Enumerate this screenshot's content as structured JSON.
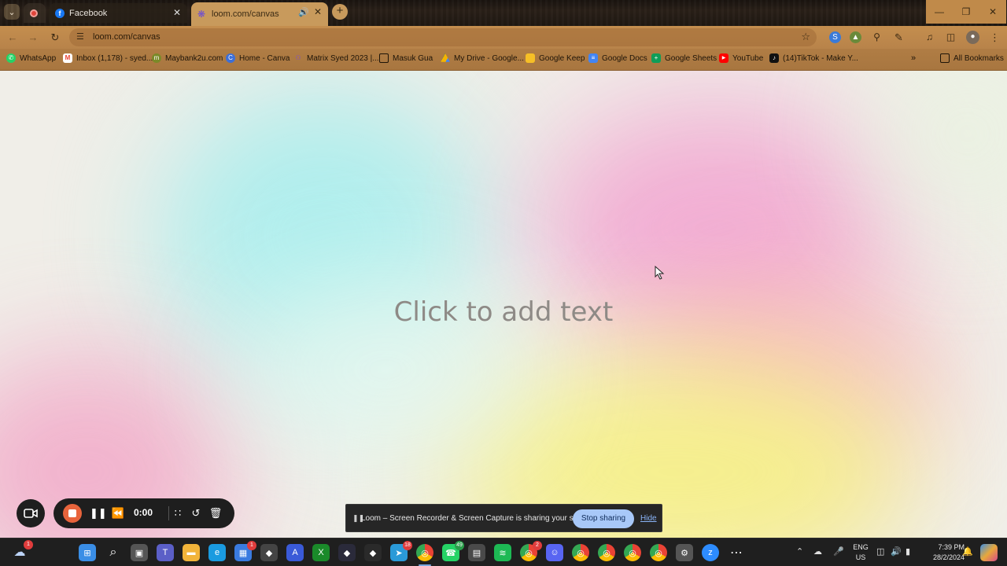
{
  "browser": {
    "tabs": [
      {
        "title": "",
        "icon": "record-icon"
      },
      {
        "title": "Facebook",
        "icon": "facebook-icon"
      },
      {
        "title": "loom.com/canvas",
        "icon": "loom-icon",
        "active": true,
        "audio": true
      }
    ],
    "address": {
      "url": "loom.com/canvas"
    },
    "bookmarks": [
      {
        "label": "WhatsApp",
        "icon": "whatsapp-icon",
        "color": "#25d366"
      },
      {
        "label": "Inbox (1,178) - syed...",
        "icon": "gmail-icon",
        "color": "#ea4335"
      },
      {
        "label": "Maybank2u.com",
        "icon": "maybank-icon",
        "color": "#7a8a28"
      },
      {
        "label": "Home - Canva",
        "icon": "canva-icon",
        "color": "#3d6fd8"
      },
      {
        "label": "Matrix Syed 2023 |...",
        "icon": "bookmark-icon",
        "color": "#9a6ad8"
      },
      {
        "label": "Masuk Gua",
        "icon": "folder-icon",
        "color": "#1e1408"
      },
      {
        "label": "My Drive - Google...",
        "icon": "drive-icon",
        "color": "#f4b400"
      },
      {
        "label": "Google Keep",
        "icon": "keep-icon",
        "color": "#f6bf26"
      },
      {
        "label": "Google Docs",
        "icon": "docs-icon",
        "color": "#4285f4"
      },
      {
        "label": "Google Sheets",
        "icon": "sheets-icon",
        "color": "#0f9d58"
      },
      {
        "label": "YouTube",
        "icon": "youtube-icon",
        "color": "#ff0000"
      },
      {
        "label": "(14)TikTok - Make Y...",
        "icon": "tiktok-icon",
        "color": "#111111"
      }
    ],
    "all_bookmarks": "All Bookmarks"
  },
  "canvas": {
    "placeholder": "Click to add text"
  },
  "recorder": {
    "time": "0:00"
  },
  "share_notice": {
    "message": "Loom – Screen Recorder & Screen Capture is sharing your screen.",
    "stop_label": "Stop sharing",
    "hide_label": "Hide"
  },
  "taskbar": {
    "apps": [
      {
        "icon": "start-icon",
        "color": "#3a8ee6"
      },
      {
        "icon": "search-icon",
        "color": "transparent"
      },
      {
        "icon": "task-view-icon",
        "color": "#555555"
      },
      {
        "icon": "teams-icon",
        "color": "#5b5fc7"
      },
      {
        "icon": "file-explorer-icon",
        "color": "#f2b43a"
      },
      {
        "icon": "edge-icon",
        "color": "#1a9be0"
      },
      {
        "icon": "store-icon",
        "color": "#3a7be0",
        "badge": "1"
      },
      {
        "icon": "app-icon",
        "color": "#444444"
      },
      {
        "icon": "affinity-icon",
        "color": "#3a5ad8"
      },
      {
        "icon": "xbox-icon",
        "color": "#1a8a2a"
      },
      {
        "icon": "app-icon",
        "color": "#2a2a3a"
      },
      {
        "icon": "app-icon",
        "color": "#2a2a2a"
      },
      {
        "icon": "telegram-icon",
        "color": "#2a9ad8",
        "badge": "18"
      },
      {
        "icon": "chrome-icon",
        "color": "#dddddd",
        "active": true
      },
      {
        "icon": "whatsapp-icon",
        "color": "#25d366",
        "badge": "49",
        "badge_color": "green"
      },
      {
        "icon": "calculator-icon",
        "color": "#4a4a4a"
      },
      {
        "icon": "spotify-icon",
        "color": "#1db954"
      },
      {
        "icon": "chrome-icon",
        "color": "#dddddd",
        "badge": "2"
      },
      {
        "icon": "discord-icon",
        "color": "#5865f2"
      },
      {
        "icon": "chrome-icon",
        "color": "#dddddd"
      },
      {
        "icon": "chrome-icon",
        "color": "#dddddd"
      },
      {
        "icon": "chrome-icon",
        "color": "#dddddd"
      },
      {
        "icon": "chrome-icon",
        "color": "#dddddd"
      },
      {
        "icon": "settings-icon",
        "color": "#555555"
      },
      {
        "icon": "zoom-icon",
        "color": "#2d8cff"
      },
      {
        "icon": "more-icon",
        "color": "transparent"
      }
    ],
    "language": [
      "ENG",
      "US"
    ],
    "time": "7:39 PM",
    "date": "28/2/2024",
    "weather_badge": "1"
  }
}
